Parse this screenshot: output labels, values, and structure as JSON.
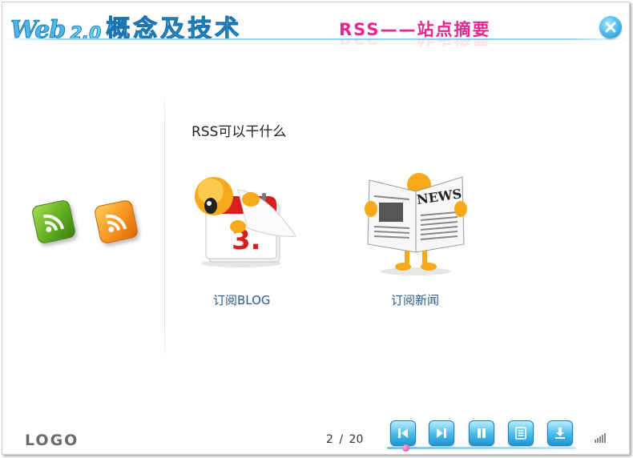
{
  "header": {
    "logo_web": "Web",
    "logo_version": "2.0",
    "logo_cn": "概念及技术",
    "section_title": "RSS——站点摘要"
  },
  "main": {
    "heading": "RSS可以干什么",
    "items": [
      {
        "label": "订阅BLOG",
        "icon": "calendar-mascot-icon"
      },
      {
        "label": "订阅新闻",
        "icon": "newspaper-mascot-icon",
        "newspaper_text": "NEWS"
      }
    ],
    "calendar_number": "3."
  },
  "footer": {
    "logo": "LOGO",
    "page_current": "2",
    "page_separator": "/",
    "page_total": "20",
    "progress": 0.1
  },
  "colors": {
    "accent": "#e8268f",
    "brand_blue": "#4fb7e8",
    "label_blue": "#2a5c8d",
    "rss_green": "#5fae1e",
    "rss_orange": "#f7931e"
  },
  "icons": [
    "close-icon",
    "rss-green-icon",
    "rss-orange-icon",
    "previous-icon",
    "next-icon",
    "pause-icon",
    "menu-icon",
    "download-icon",
    "volume-icon"
  ]
}
